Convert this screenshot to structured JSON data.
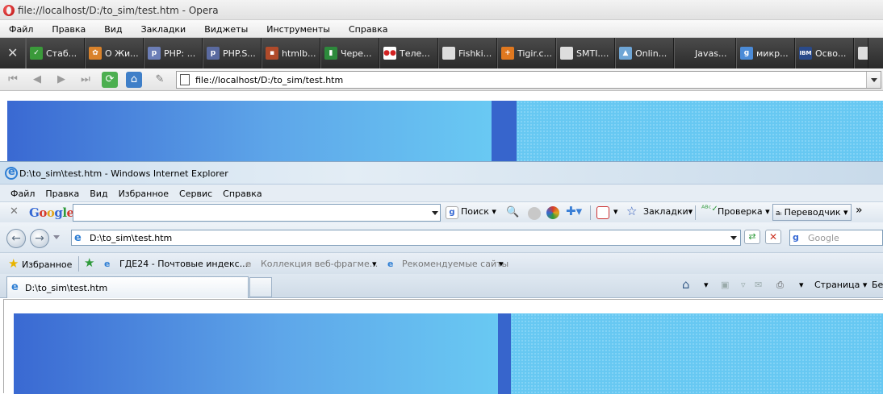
{
  "opera": {
    "title": "file://localhost/D:/to_sim/test.htm - Opera",
    "menu": [
      "Файл",
      "Правка",
      "Вид",
      "Закладки",
      "Виджеты",
      "Инструменты",
      "Справка"
    ],
    "bookmarks": [
      {
        "label": "Стаб...",
        "icon": "checkmark-icon",
        "color": "#3a9a3a"
      },
      {
        "label": "О Жи...",
        "icon": "gear-icon",
        "color": "#d9822b"
      },
      {
        "label": "PHP: ...",
        "icon": "php-icon",
        "color": "#6c7eb7"
      },
      {
        "label": "PHP.S...",
        "icon": "php-icon",
        "color": "#5a6aa0"
      },
      {
        "label": "htmlb...",
        "icon": "blocks-icon",
        "color": "#b04a2a"
      },
      {
        "label": "Чере...",
        "icon": "bars-icon",
        "color": "#2d8a3c"
      },
      {
        "label": "Теле...",
        "icon": "dots-icon",
        "color": "#d32222"
      },
      {
        "label": "Fishki...",
        "icon": "page-icon",
        "color": "#dddddd"
      },
      {
        "label": "Tigir.c...",
        "icon": "plus-icon",
        "color": "#e0781f"
      },
      {
        "label": "SMTI....",
        "icon": "page-icon",
        "color": "#dddddd"
      },
      {
        "label": "Onlin...",
        "icon": "triangle-icon",
        "color": "#6fa6d6"
      },
      {
        "label": "Javas...",
        "icon": "blank-icon",
        "color": "#333333"
      },
      {
        "label": "микр...",
        "icon": "google-icon",
        "color": "#4b8bd7"
      },
      {
        "label": "Осво...",
        "icon": "ibm-icon",
        "color": "#2a4a8a"
      }
    ],
    "address": "file://localhost/D:/to_sim/test.htm"
  },
  "ie": {
    "title": "D:\\to_sim\\test.htm - Windows Internet Explorer",
    "menu": [
      "Файл",
      "Правка",
      "Вид",
      "Избранное",
      "Сервис",
      "Справка"
    ],
    "google": {
      "logo": "Google",
      "search_label": "Поиск",
      "bookmarks_label": "Закладки",
      "check_label": "Проверка",
      "translate_label": "Переводчик",
      "more": "»"
    },
    "address": "D:\\to_sim\\test.htm",
    "search_placeholder": "Google",
    "favorites": {
      "label": "Избранное",
      "items": [
        "ГДЕ24 - Почтовые индекс...",
        "Коллекция веб-фрагме...",
        "Рекомендуемые сайты"
      ]
    },
    "tab": "D:\\to_sim\\test.htm",
    "commands": {
      "page": "Страница",
      "cut": "Бе"
    }
  },
  "colors": {
    "gradient_start": "#3a69d2",
    "gradient_end": "#69c9f3",
    "bar": "#3765cc",
    "dots": "#67c8f2"
  }
}
